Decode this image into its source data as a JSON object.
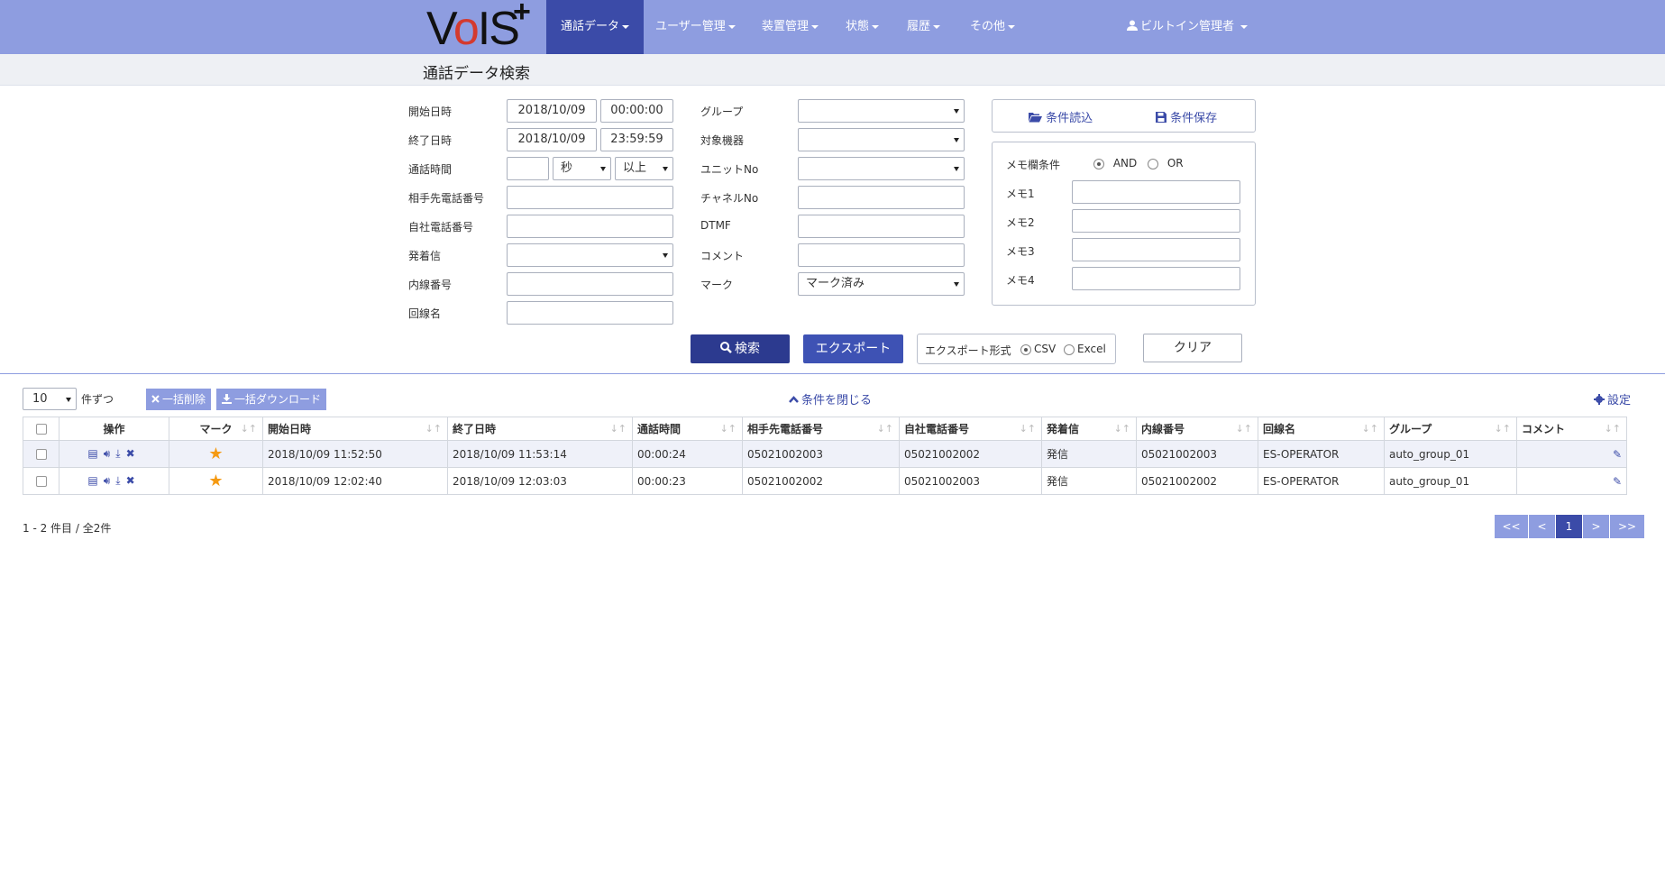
{
  "app": {
    "logo_text": "VoIS+"
  },
  "nav": {
    "items": [
      {
        "label": "通話データ"
      },
      {
        "label": "ユーザー管理"
      },
      {
        "label": "装置管理"
      },
      {
        "label": "状態"
      },
      {
        "label": "履歴"
      },
      {
        "label": "その他"
      }
    ],
    "user": "ビルトイン管理者"
  },
  "page": {
    "title": "通話データ検索"
  },
  "form": {
    "start_label": "開始日時",
    "start_date": "2018/10/09",
    "start_time": "00:00:00",
    "end_label": "終了日時",
    "end_date": "2018/10/09",
    "end_time": "23:59:59",
    "duration_label": "通話時間",
    "duration_value": "",
    "duration_unit": "秒",
    "duration_cond": "以上",
    "partner_label": "相手先電話番号",
    "partner_value": "",
    "own_label": "自社電話番号",
    "own_value": "",
    "direction_label": "発着信",
    "direction_value": "",
    "extension_label": "内線番号",
    "extension_value": "",
    "line_label": "回線名",
    "line_value": "",
    "group_label": "グループ",
    "group_value": "",
    "device_label": "対象機器",
    "device_value": "",
    "unit_label": "ユニットNo",
    "unit_value": "",
    "channel_label": "チャネルNo",
    "channel_value": "",
    "dtmf_label": "DTMF",
    "dtmf_value": "",
    "comment_label": "コメント",
    "comment_value": "",
    "mark_label": "マーク",
    "mark_value": "マーク済み",
    "load_conditions": "条件読込",
    "save_conditions": "条件保存",
    "memo_condition_label": "メモ欄条件",
    "memo_and": "AND",
    "memo_or": "OR",
    "memo1_label": "メモ1",
    "memo2_label": "メモ2",
    "memo3_label": "メモ3",
    "memo4_label": "メモ4",
    "search_button": "検索",
    "export_button": "エクスポート",
    "export_format_label": "エクスポート形式",
    "export_csv": "CSV",
    "export_excel": "Excel",
    "clear_button": "クリア"
  },
  "toolbar": {
    "page_size": "10",
    "page_size_suffix": "件ずつ",
    "bulk_delete": "一括削除",
    "bulk_download": "一括ダウンロード",
    "close_conditions": "条件を閉じる",
    "settings": "設定"
  },
  "table": {
    "headers": [
      "操作",
      "マーク",
      "開始日時",
      "終了日時",
      "通話時間",
      "相手先電話番号",
      "自社電話番号",
      "発着信",
      "内線番号",
      "回線名",
      "グループ",
      "コメント"
    ],
    "rows": [
      {
        "mark": "★",
        "start": "2018/10/09 11:52:50",
        "end": "2018/10/09 11:53:14",
        "duration": "00:00:24",
        "partner": "05021002003",
        "own": "05021002002",
        "direction": "発信",
        "extension": "05021002003",
        "line": "ES-OPERATOR",
        "group": "auto_group_01",
        "comment": ""
      },
      {
        "mark": "★",
        "start": "2018/10/09 12:02:40",
        "end": "2018/10/09 12:03:03",
        "duration": "00:00:23",
        "partner": "05021002002",
        "own": "05021002003",
        "direction": "発信",
        "extension": "05021002002",
        "line": "ES-OPERATOR",
        "group": "auto_group_01",
        "comment": ""
      }
    ]
  },
  "footer": {
    "summary": "1 - 2 件目 / 全2件",
    "first": "<<",
    "prev": "<",
    "current": "1",
    "next": ">",
    "last": ">>"
  },
  "icons": {
    "detail": "list-icon",
    "play": "speaker-icon",
    "download": "download-icon",
    "delete": "close-icon",
    "edit": "pencil-icon",
    "user": "user-icon",
    "folder": "folder-open-icon",
    "save": "floppy-icon",
    "search": "search-icon",
    "settings": "gear-icon",
    "chevron": "chevron-up-icon"
  },
  "colors": {
    "nav": "#8e9de0",
    "nav_active": "#3b4ba8",
    "primary": "#2c3a8f",
    "star": "#f59a12"
  }
}
